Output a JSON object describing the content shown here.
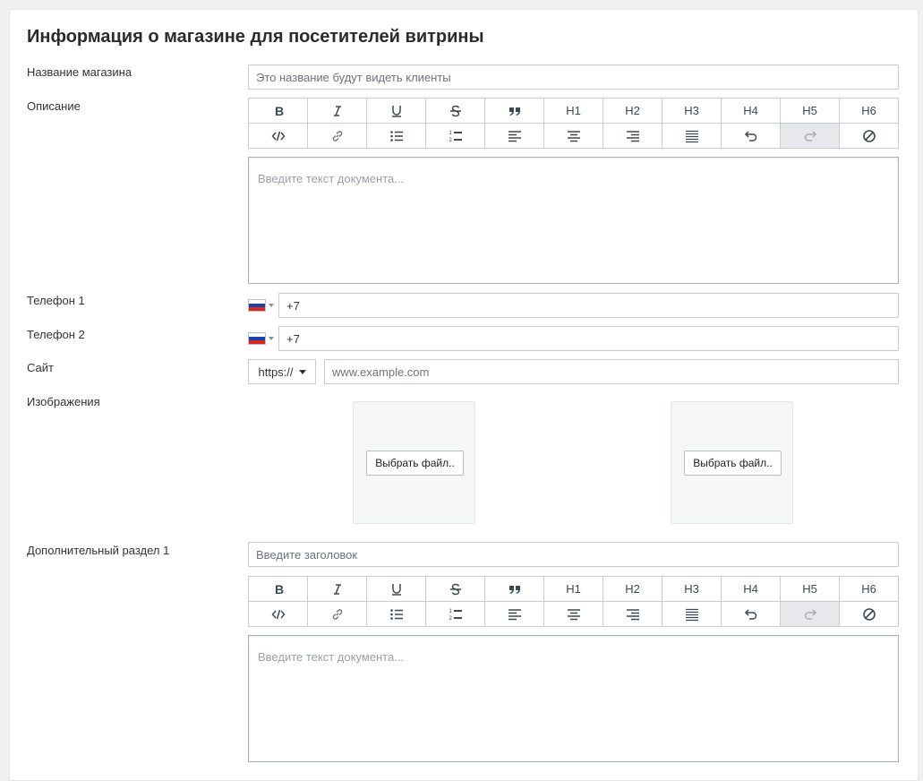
{
  "page": {
    "title": "Информация о магазине для посетителей витрины"
  },
  "fields": {
    "shop_name_label": "Название магазина",
    "shop_name_placeholder": "Это название будут видеть клиенты",
    "description_label": "Описание",
    "editor_placeholder": "Введите текст документа...",
    "phone1_label": "Телефон 1",
    "phone1_value": "+7",
    "phone2_label": "Телефон 2",
    "phone2_value": "+7",
    "site_label": "Сайт",
    "site_protocol": "https://",
    "site_placeholder": "www.example.com",
    "images_label": "Изображения",
    "file_button": "Выбрать файл..",
    "extra1_label": "Дополнительный раздел 1",
    "extra1_placeholder": "Введите заголовок"
  },
  "toolbar": {
    "headings": [
      "H1",
      "H2",
      "H3",
      "H4",
      "H5",
      "H6"
    ]
  },
  "flag": {
    "country": "ru",
    "colors": [
      "#ffffff",
      "#1c3fa8",
      "#d52b1e"
    ]
  },
  "colors": {
    "accent_text": "#3f4850",
    "disabled_bg": "#e6e8eb"
  }
}
